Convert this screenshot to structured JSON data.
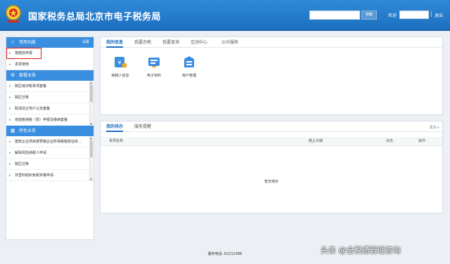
{
  "header": {
    "site_title": "国家税务总局北京市电子税务局",
    "search_placeholder": "",
    "search_button": "搜索",
    "welcome": "欢迎",
    "separator": "|",
    "logout": "退出"
  },
  "sidebar": {
    "sections": [
      {
        "title": "常用功能",
        "extra": "设置",
        "icon": "star-icon",
        "items": [
          "按期自申报",
          "发票使用"
        ]
      },
      {
        "title": "套餐业务",
        "icon": "gear-icon",
        "items": [
          "跨区域涉税事项套餐",
          "跨区迁移",
          "取消非正常户认定套餐",
          "增值税纳税（费）申报及缴纳套餐"
        ]
      },
      {
        "title": "特色业务",
        "icon": "grid-icon",
        "items": [
          "建筑企业项目部预缴企业所得税税款征收...",
          "解除风险纳税人申请",
          "跨区迁移",
          "非营利组织免税资格申请"
        ]
      }
    ]
  },
  "panel1": {
    "tabs": [
      "我的信息",
      "我要办税",
      "我要查询",
      "互动中心",
      "公众服务"
    ],
    "apps": [
      {
        "label": "纳税人信息",
        "icon": "taxpayer-info-icon",
        "color": "#3a8ee0"
      },
      {
        "label": "电子资料",
        "icon": "e-docs-icon",
        "color": "#3a8ee0"
      },
      {
        "label": "用户管理",
        "icon": "user-mgmt-icon",
        "color": "#3a8ee0"
      }
    ]
  },
  "panel2": {
    "tabs": [
      "我的待办",
      "服务提醒"
    ],
    "more": "更多>",
    "columns": [
      "事项名称",
      "截止日期",
      "状态",
      "操作"
    ],
    "empty": "暂无待办"
  },
  "footer": {
    "text": "服务电话: 62212366"
  },
  "watermark": {
    "text": "头条 @全税通管理咨询"
  },
  "colors": {
    "header": "#1d6fc0",
    "accent": "#3a8ee0",
    "highlight_box": "#e01818"
  }
}
